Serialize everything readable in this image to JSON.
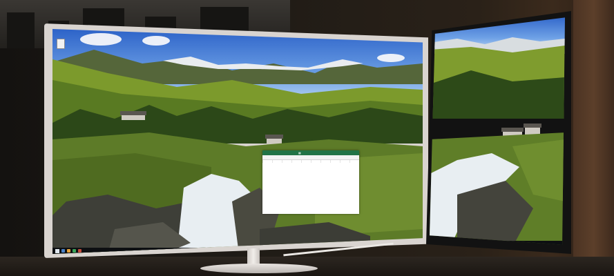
{
  "scene": {
    "description_free": true,
    "colors": {
      "sky": "#5b8fdc",
      "grass": "#6f8f2a",
      "forest": "#2f4a18",
      "rock": "#4a4a44",
      "water": "#eef2f5",
      "monitor_bezel_left": "#d9d4d0",
      "monitor_bezel_right": "#121212",
      "excel_green": "#217346",
      "taskbar": "#0d0f12"
    }
  },
  "left_monitor": {
    "desktop_icon": "document-icon",
    "excel_window": {
      "icon": "spreadsheet-icon"
    },
    "taskbar": {
      "start_icon": "windows-start-icon"
    }
  },
  "right_monitor": {
    "taskbar": {
      "start_icon": "windows-start-icon"
    }
  }
}
